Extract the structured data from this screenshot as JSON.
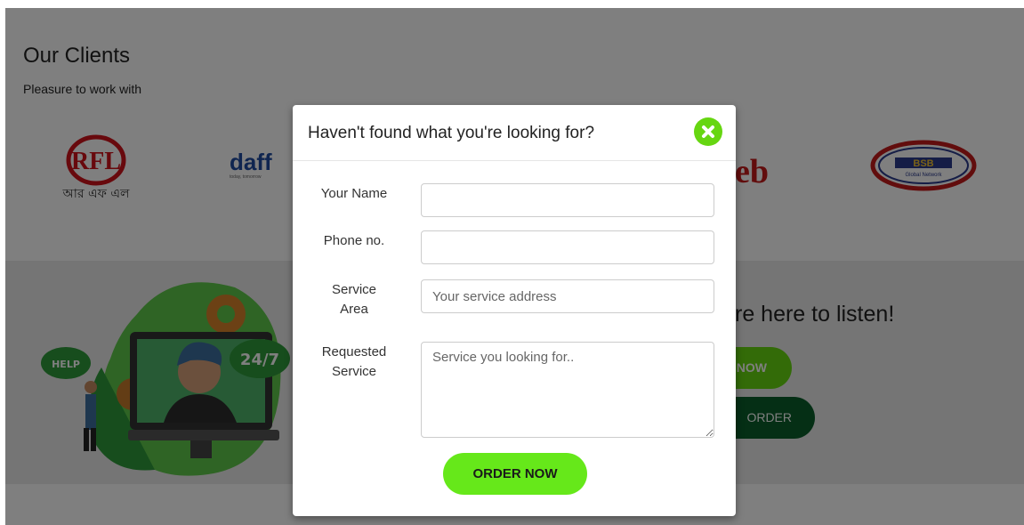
{
  "clients": {
    "title": "Our Clients",
    "subtitle": "Pleasure to work with",
    "logos": [
      {
        "name": "afl-logo",
        "text": "আর এফ এল",
        "mark": "RFL"
      },
      {
        "name": "daffodil-logo",
        "text": "daff",
        "tagline": "today, tomorrow"
      },
      {
        "name": "eb-logo",
        "text": "eb"
      },
      {
        "name": "bsb-logo",
        "text": "BSB",
        "tagline": "Global Network"
      }
    ]
  },
  "help": {
    "headline": "re here to listen!",
    "call_label": "NOW",
    "order_label": "ORDER",
    "bubble_help": "HELP",
    "bubble_247": "24/7"
  },
  "modal": {
    "title": "Haven't found what you're looking for?",
    "fields": {
      "name_label": "Your Name",
      "name_value": "",
      "phone_label": "Phone no.",
      "phone_value": "",
      "area_label_1": "Service",
      "area_label_2": "Area",
      "area_placeholder": "Your service address",
      "service_label_1": "Requested",
      "service_label_2": "Service",
      "service_placeholder": "Service you looking for.."
    },
    "submit_label": "ORDER NOW"
  },
  "colors": {
    "accent_green": "#66e81a",
    "dark_green": "#0a5e2a",
    "overlay": "rgba(0,0,0,0.5)"
  }
}
